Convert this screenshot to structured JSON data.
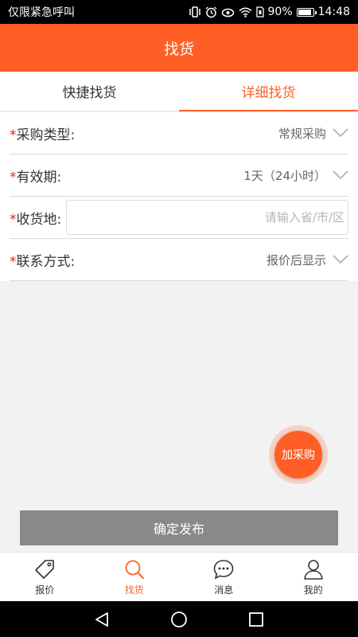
{
  "status_bar": {
    "carrier": "仅限紧急呼叫",
    "battery": "90%",
    "battery_level": 0.9,
    "time": "14:48",
    "icons": [
      "vibrate-icon",
      "alarm-icon",
      "eye-icon",
      "wifi-icon",
      "sim-icon",
      "battery-icon"
    ]
  },
  "header": {
    "title": "找货"
  },
  "tabs": [
    {
      "label": "快捷找货",
      "active": false
    },
    {
      "label": "详细找货",
      "active": true
    }
  ],
  "form": {
    "required_mark": "*",
    "purchase_type": {
      "label": "采购类型:",
      "value": "常规采购"
    },
    "validity": {
      "label": "有效期:",
      "value": "1天（24小时）"
    },
    "delivery": {
      "label": "收货地:",
      "placeholder": "请输入省/市/区",
      "value": ""
    },
    "contact": {
      "label": "联系方式:",
      "value": "报价后显示"
    }
  },
  "fab": {
    "label": "加采购"
  },
  "publish_button": {
    "label": "确定发布"
  },
  "bottom_nav": [
    {
      "label": "报价",
      "icon": "tag-icon",
      "active": false
    },
    {
      "label": "找货",
      "icon": "search-icon",
      "active": true
    },
    {
      "label": "消息",
      "icon": "chat-icon",
      "active": false
    },
    {
      "label": "我的",
      "icon": "user-icon",
      "active": false
    }
  ],
  "colors": {
    "accent": "#ff5f26",
    "required": "#e6231b",
    "publish_disabled": "#898989"
  }
}
